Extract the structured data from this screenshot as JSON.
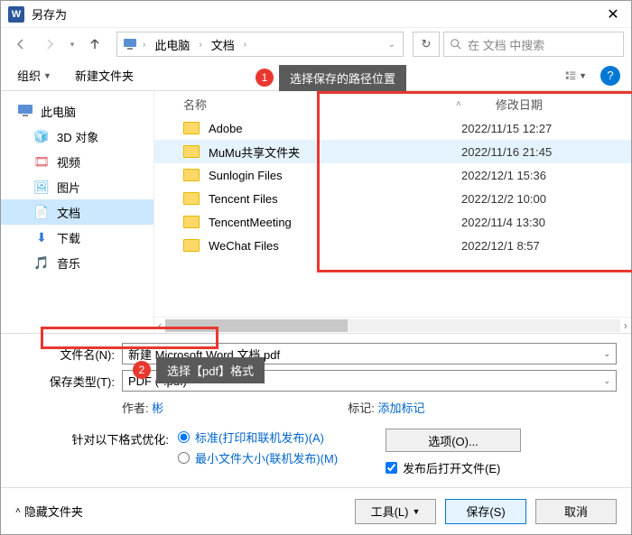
{
  "title": "另存为",
  "nav": {
    "this_pc": "此电脑",
    "current": "文档",
    "search_placeholder": "在 文档 中搜索"
  },
  "toolbar": {
    "organize": "组织",
    "new_folder": "新建文件夹"
  },
  "callouts": {
    "c1": "选择保存的路径位置",
    "c1_num": "1",
    "c2": "选择【pdf】格式",
    "c2_num": "2"
  },
  "sidebar": {
    "this_pc": "此电脑",
    "items": [
      {
        "label": "3D 对象",
        "ic": "🧊"
      },
      {
        "label": "视频",
        "ic": "🎞"
      },
      {
        "label": "图片",
        "ic": "🖼"
      },
      {
        "label": "文档",
        "ic": "📄",
        "sel": true
      },
      {
        "label": "下载",
        "ic": "⬇"
      },
      {
        "label": "音乐",
        "ic": "🎵"
      }
    ]
  },
  "list": {
    "col_name": "名称",
    "col_date": "修改日期",
    "rows": [
      {
        "name": "Adobe",
        "date": "2022/11/15 12:27"
      },
      {
        "name": "MuMu共享文件夹",
        "date": "2022/11/16 21:45",
        "sel": true
      },
      {
        "name": "Sunlogin Files",
        "date": "2022/12/1 15:36"
      },
      {
        "name": "Tencent Files",
        "date": "2022/12/2 10:00"
      },
      {
        "name": "TencentMeeting",
        "date": "2022/11/4 13:30"
      },
      {
        "name": "WeChat Files",
        "date": "2022/12/1 8:57"
      }
    ]
  },
  "form": {
    "filename_label": "文件名(N):",
    "filename_value": "新建 Microsoft Word 文档.pdf",
    "filetype_label": "保存类型(T):",
    "filetype_value": "PDF (*.pdf)",
    "author_label": "作者:",
    "author_value": "彬",
    "tags_label": "标记:",
    "tags_value": "添加标记",
    "optimize_label": "针对以下格式优化:",
    "opt_standard": "标准(打印和联机发布)(A)",
    "opt_min": "最小文件大小(联机发布)(M)",
    "options_btn": "选项(O)...",
    "open_after": "发布后打开文件(E)"
  },
  "footer": {
    "hide_folders": "隐藏文件夹",
    "tools": "工具(L)",
    "save": "保存(S)",
    "cancel": "取消"
  }
}
